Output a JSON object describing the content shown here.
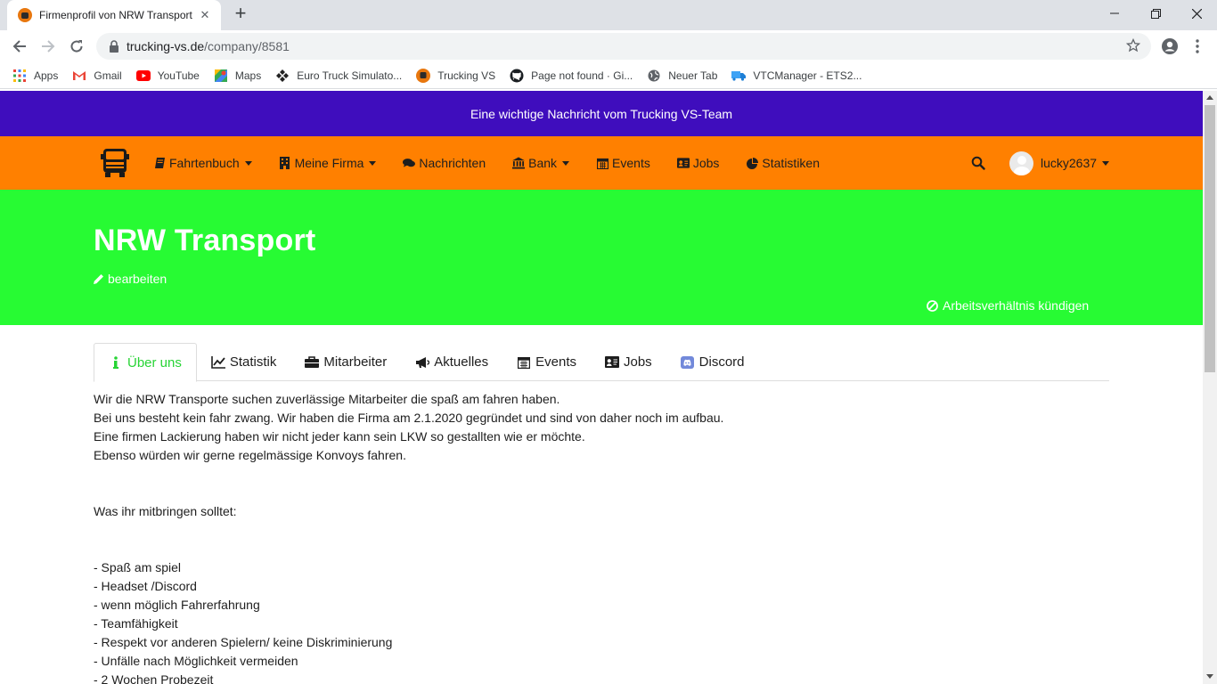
{
  "browser": {
    "tab_title": "Firmenprofil von NRW Transport",
    "url_host": "trucking-vs.de",
    "url_path": "/company/8581",
    "bookmarks": [
      {
        "label": "Apps",
        "icon": "apps-grid-icon"
      },
      {
        "label": "Gmail",
        "icon": "gmail-icon"
      },
      {
        "label": "YouTube",
        "icon": "youtube-icon"
      },
      {
        "label": "Maps",
        "icon": "maps-icon"
      },
      {
        "label": "Euro Truck Simulato...",
        "icon": "ets-icon"
      },
      {
        "label": "Trucking VS",
        "icon": "trucking-vs-icon"
      },
      {
        "label": "Page not found · Gi...",
        "icon": "github-icon"
      },
      {
        "label": "Neuer Tab",
        "icon": "globe-icon"
      },
      {
        "label": "VTCManager - ETS2...",
        "icon": "truck-icon"
      }
    ]
  },
  "site": {
    "announcement": "Eine wichtige Nachricht vom Trucking VS-Team",
    "nav": [
      {
        "label": "Fahrtenbuch",
        "icon": "book-icon",
        "dropdown": true
      },
      {
        "label": "Meine Firma",
        "icon": "building-icon",
        "dropdown": true
      },
      {
        "label": "Nachrichten",
        "icon": "comments-icon",
        "dropdown": false
      },
      {
        "label": "Bank",
        "icon": "bank-icon",
        "dropdown": true
      },
      {
        "label": "Events",
        "icon": "calendar-icon",
        "dropdown": false
      },
      {
        "label": "Jobs",
        "icon": "id-card-icon",
        "dropdown": false
      },
      {
        "label": "Statistiken",
        "icon": "pie-chart-icon",
        "dropdown": false
      }
    ],
    "username": "lucky2637",
    "colors": {
      "announcement": "#3f0dbd",
      "nav": "#ff8000",
      "hero": "#27fb33",
      "active_tab": "#27d435"
    }
  },
  "company": {
    "name": "NRW Transport",
    "edit_label": "bearbeiten",
    "quit_label": "Arbeitsverhältnis kündigen"
  },
  "tabs": [
    {
      "label": "Über uns",
      "icon": "info-icon",
      "active": true
    },
    {
      "label": "Statistik",
      "icon": "line-chart-icon",
      "active": false
    },
    {
      "label": "Mitarbeiter",
      "icon": "briefcase-icon",
      "active": false
    },
    {
      "label": "Aktuelles",
      "icon": "megaphone-icon",
      "active": false
    },
    {
      "label": "Events",
      "icon": "calendar-icon",
      "active": false
    },
    {
      "label": "Jobs",
      "icon": "id-card-icon",
      "active": false
    },
    {
      "label": "Discord",
      "icon": "discord-icon",
      "active": false
    }
  ],
  "about": {
    "intro": [
      "Wir die NRW Transporte suchen zuverlässige Mitarbeiter die spaß am fahren haben.",
      "Bei uns besteht kein fahr zwang. Wir haben die Firma am 2.1.2020 gegründet und sind von daher noch im aufbau.",
      "Eine firmen Lackierung haben wir nicht jeder kann sein LKW so gestallten wie er möchte.",
      "Ebenso würden wir gerne regelmässige Konvoys fahren."
    ],
    "requirements_heading": "Was ihr mitbringen solltet:",
    "requirements": [
      "- Spaß am spiel",
      "- Headset /Discord",
      "- wenn möglich Fahrerfahrung",
      "- Teamfähigkeit",
      "- Respekt vor anderen Spielern/ keine Diskriminierung",
      "- Unfälle nach Möglichkeit vermeiden",
      "- 2 Wochen Probezeit"
    ]
  }
}
